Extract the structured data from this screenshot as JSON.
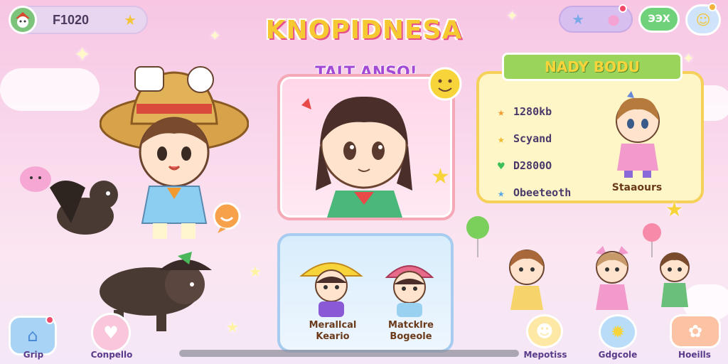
{
  "top_bar": {
    "coins": "F1020",
    "green_button": "ЭЭX"
  },
  "title": "KNOPIDNESA",
  "subtitle": "TALT ANSO!",
  "info_panel": {
    "ribbon": "NADY BODU",
    "stats": [
      {
        "icon": "star-icon",
        "color": "#f29a2e",
        "text": "1280kb"
      },
      {
        "icon": "star-icon",
        "color": "#f2b82e",
        "text": "Scyand"
      },
      {
        "icon": "leaf-icon",
        "color": "#3cbf58",
        "text": "D2800O"
      },
      {
        "icon": "star-icon",
        "color": "#5aa8e8",
        "text": "Obeeteoth"
      }
    ],
    "character_label": "Staaours"
  },
  "select_card": {
    "options": [
      {
        "line1": "Merallcal",
        "line2": "Keario"
      },
      {
        "line1": "Matcklre",
        "line2": "Bogeole"
      }
    ]
  },
  "bottom_nav": [
    {
      "label": "Grip",
      "icon": "home-icon",
      "bg": "#a9d3f5"
    },
    {
      "label": "Conpello",
      "icon": "bag-icon",
      "bg": "#f9c6dc"
    },
    {
      "label": "Mepotiss",
      "icon": "cat-icon",
      "bg": "#fde8a6"
    },
    {
      "label": "Gdgcole",
      "icon": "sun-icon",
      "bg": "#b9dcf8"
    },
    {
      "label": "Hoeills",
      "icon": "flower-icon",
      "bg": "#fbc3a4"
    }
  ],
  "colors": {
    "title": "#f6c933",
    "subtitle": "#a24ad6",
    "ribbon": "#9bd45a",
    "panel_border": "#f5d15a"
  }
}
